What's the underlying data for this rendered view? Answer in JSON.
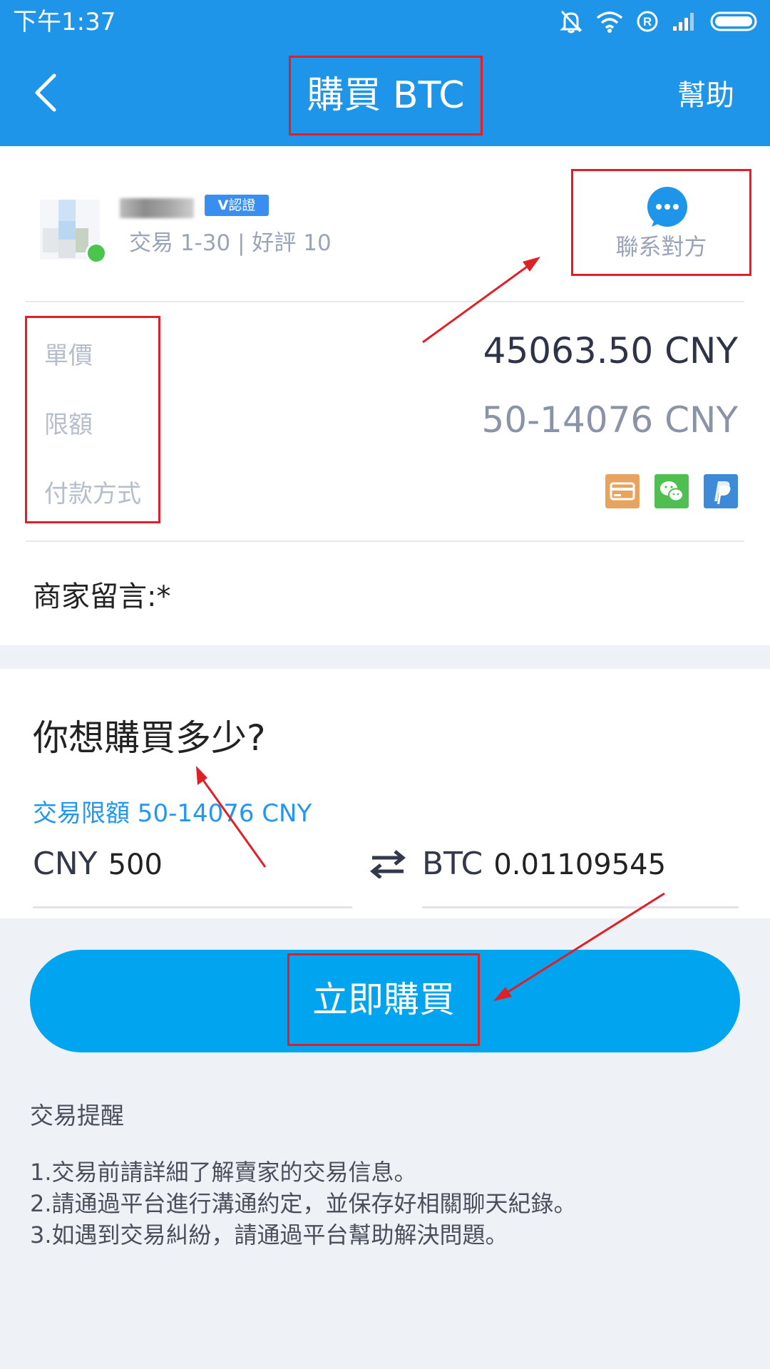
{
  "status_bar": {
    "time": "下午1:37"
  },
  "header": {
    "title": "購買 BTC",
    "help_label": "幫助"
  },
  "merchant": {
    "verified_badge": "認證",
    "stats": "交易 1-30 | 好評 10",
    "contact_label": "聯系對方"
  },
  "details": {
    "price_label": "單價",
    "price_value": "45063.50 CNY",
    "limit_label": "限額",
    "limit_value": "50-14076 CNY",
    "payment_label": "付款方式",
    "payment_methods": [
      "bank-card-icon",
      "wechat-icon",
      "paypal-icon"
    ]
  },
  "merchant_message_label": "商家留言:*",
  "purchase": {
    "question": "你想購買多少?",
    "limit_hint": "交易限額 50-14076 CNY",
    "fiat_currency": "CNY",
    "fiat_amount": "500",
    "crypto_currency": "BTC",
    "crypto_amount": "0.01109545",
    "buy_button_label": "立即購買"
  },
  "tips": {
    "title": "交易提醒",
    "items": [
      "1.交易前請詳細了解賣家的交易信息。",
      "2.請通過平台進行溝通約定，並保存好相關聊天紀錄。",
      "3.如遇到交易糾紛，請通過平台幫助解決問題。"
    ]
  },
  "colors": {
    "header_blue": "#1f95ea",
    "button_blue": "#00a4ef",
    "annotation_red": "#e01f26",
    "online_green": "#4cc54e"
  }
}
